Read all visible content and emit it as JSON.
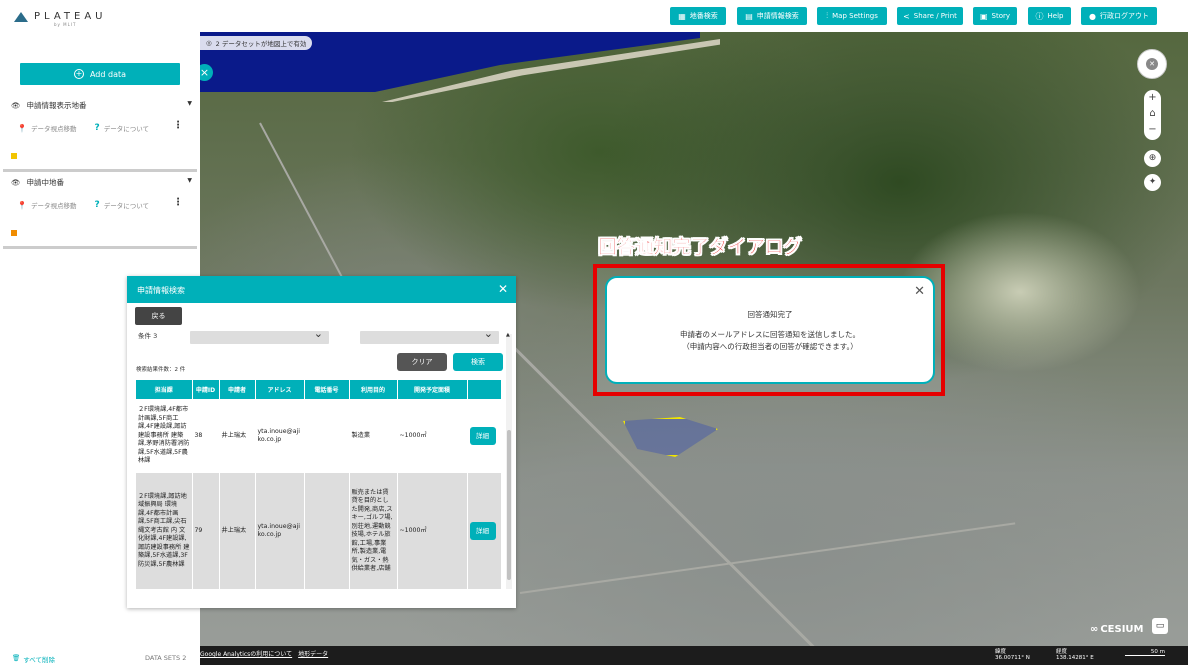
{
  "header": {
    "logo_text": "PLATEAU",
    "logo_sub": "by MLIT",
    "buttons": [
      {
        "label": "地番検索",
        "icon": "map-icon"
      },
      {
        "label": "申請情報検索",
        "icon": "document-icon"
      },
      {
        "label": "Map Settings",
        "icon": "settings-sliders-icon"
      },
      {
        "label": "Share / Print",
        "icon": "share-icon"
      },
      {
        "label": "Story",
        "icon": "story-icon"
      },
      {
        "label": "Help",
        "icon": "help-icon"
      },
      {
        "label": "行政ログアウト",
        "icon": "user-icon"
      }
    ]
  },
  "sidebar": {
    "add_data": "Add data",
    "layers": [
      {
        "title": "申請情報表示地番",
        "move": "データ視点移動",
        "about": "データについて",
        "legend_color": "#f2c400"
      },
      {
        "title": "申請中地番",
        "move": "データ視点移動",
        "about": "データについて",
        "legend_color": "#f08c00"
      }
    ],
    "delete_all": "すべて削除",
    "datasets": "DATA SETS 2"
  },
  "map": {
    "note": "2 データセットが地図上で有効",
    "footer_links": [
      "Google Analyticsの利用について",
      "地形データ"
    ],
    "lat_label": "緯度",
    "lat_value": "36.00711° N",
    "lon_label": "経度",
    "lon_value": "138.14281° E",
    "scale": "50 m",
    "cesium": "CESIUM"
  },
  "search_dialog": {
    "title": "申請情報検索",
    "back": "戻る",
    "condition_label": "条件 3",
    "clear": "クリア",
    "search": "検索",
    "result_count": "検索結果件数：2 件",
    "columns": [
      "担当課",
      "申請ID",
      "申請者",
      "アドレス",
      "電話番号",
      "利用目的",
      "開発予定面積",
      ""
    ],
    "rows": [
      {
        "dept": "２F環境課,4F都市計画課,5F商工課,4F建設課,諏訪建設事務所 建築課,茅野消防署消防課,5F水道課,5F農林課",
        "id": "38",
        "applicant": "井上瑞太",
        "address": "yta.inoue@ajiko.co.jp",
        "phone": "",
        "purpose": "製造業",
        "area": "~1000㎡",
        "detail": "詳細"
      },
      {
        "dept": "２F環境課,諏訪地域振興局 環境課,4F都市計画課,5F商工課,尖石縄文考古館 内 文化財課,4F建設課,諏訪建設事務所 建築課,5F水道課,3F防災課,5F農林課",
        "id": "79",
        "applicant": "井上瑞太",
        "address": "yta.inoue@ajiko.co.jp",
        "phone": "",
        "purpose": "販売または賃貸を目的とした開発,商店,スキー,ゴルフ場,別荘地,運動競技場,ホテル旅館,工場,事業所,製造業,電気・ガス・熱供給業者,店舗",
        "area": "~1000㎡",
        "detail": "詳細"
      }
    ]
  },
  "annotation": {
    "title": "回答通知完了ダイアログ"
  },
  "dialog": {
    "title": "回答通知完了",
    "message1": "申請者のメールアドレスに回答通知を送信しました。",
    "message2": "（申請内容への行政担当者の回答が確認できます。）"
  },
  "colors": {
    "accent": "#00b0b9",
    "annotation_red": "#e60000"
  }
}
